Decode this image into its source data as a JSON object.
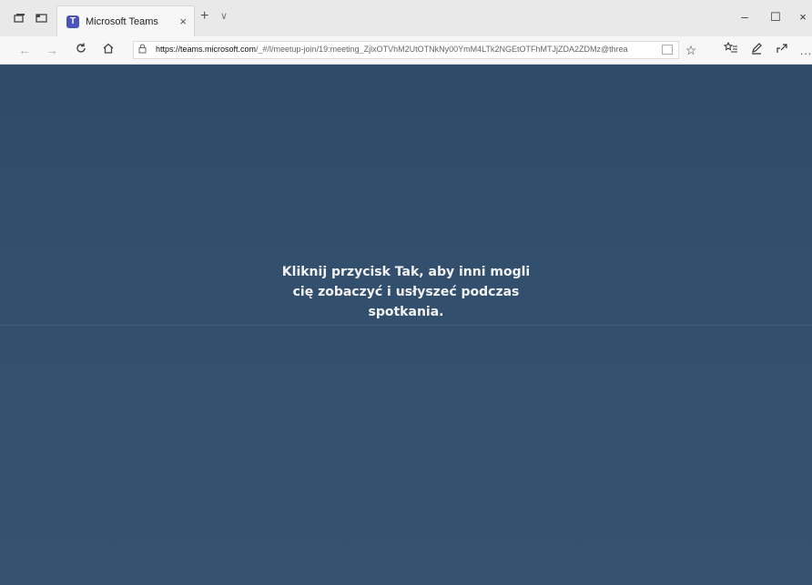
{
  "browser": {
    "tab_title": "Microsoft Teams",
    "tab_close": "×",
    "new_tab": "+",
    "tab_menu": "∨",
    "icons": {
      "tab_set_aside": "tab-set-aside-icon",
      "tab_preview": "tab-preview-icon",
      "teams_logo": "teams-logo-icon"
    },
    "url_domain": "https://teams.microsoft.com",
    "url_path": "/_#/l/meetup-join/19:meeting_ZjlxOTVhM2UtOTNkNy00YmM4LTk2NGEtOTFhMTJjZDA2ZDMz@threa",
    "window": {
      "minimize": "–",
      "maximize": "☐",
      "close": "×"
    }
  },
  "meeting": {
    "message_line1": "Kliknij przycisk Tak, aby inni mogli",
    "message_line2": "cię zobaczyć i usłyszeć podczas",
    "message_line3": "spotkania."
  },
  "colors": {
    "content_bg": "#32506e",
    "text": "#f2f2f2",
    "teams_brand": "#4b53bc"
  }
}
